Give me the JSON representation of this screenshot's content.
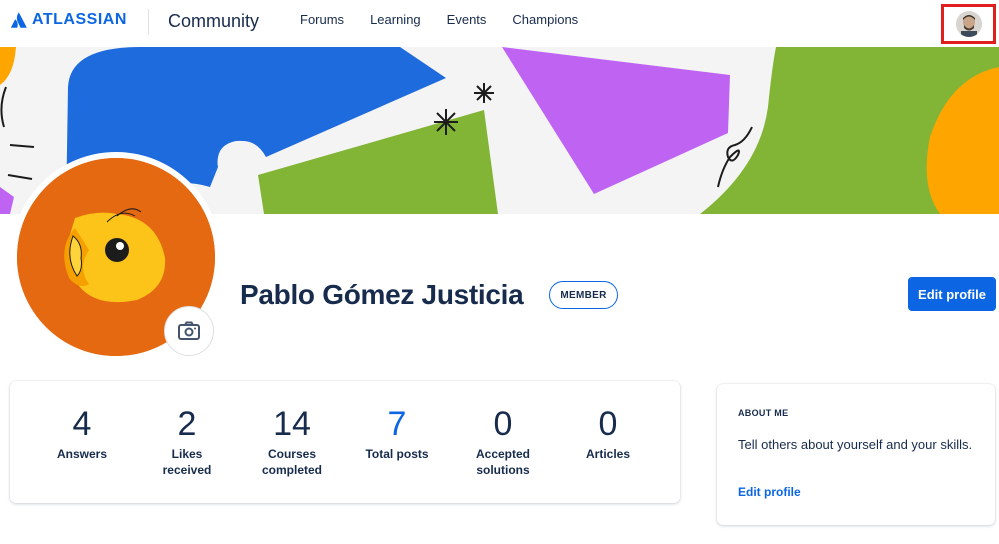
{
  "brand": {
    "logo_text": "ATLASSIAN",
    "product": "Community"
  },
  "nav": {
    "items": [
      "Forums",
      "Learning",
      "Events",
      "Champions"
    ]
  },
  "profile": {
    "name": "Pablo Gómez Justicia",
    "badge": "MEMBER",
    "edit_label": "Edit profile"
  },
  "stats": [
    {
      "value": "4",
      "label": "Answers"
    },
    {
      "value": "2",
      "label": "Likes received"
    },
    {
      "value": "14",
      "label": "Courses completed"
    },
    {
      "value": "7",
      "label": "Total posts"
    },
    {
      "value": "0",
      "label": "Accepted solutions"
    },
    {
      "value": "0",
      "label": "Articles"
    }
  ],
  "about": {
    "title": "ABOUT ME",
    "text": "Tell others about yourself and your skills.",
    "link": "Edit profile"
  },
  "colors": {
    "accent": "#0c66e4",
    "avatar_bg": "#e56910",
    "bird": "#fcc419",
    "banner_blue": "#1d6bdc",
    "banner_purple": "#bf63f3",
    "banner_green": "#82b536",
    "banner_orange": "#ffa500"
  }
}
